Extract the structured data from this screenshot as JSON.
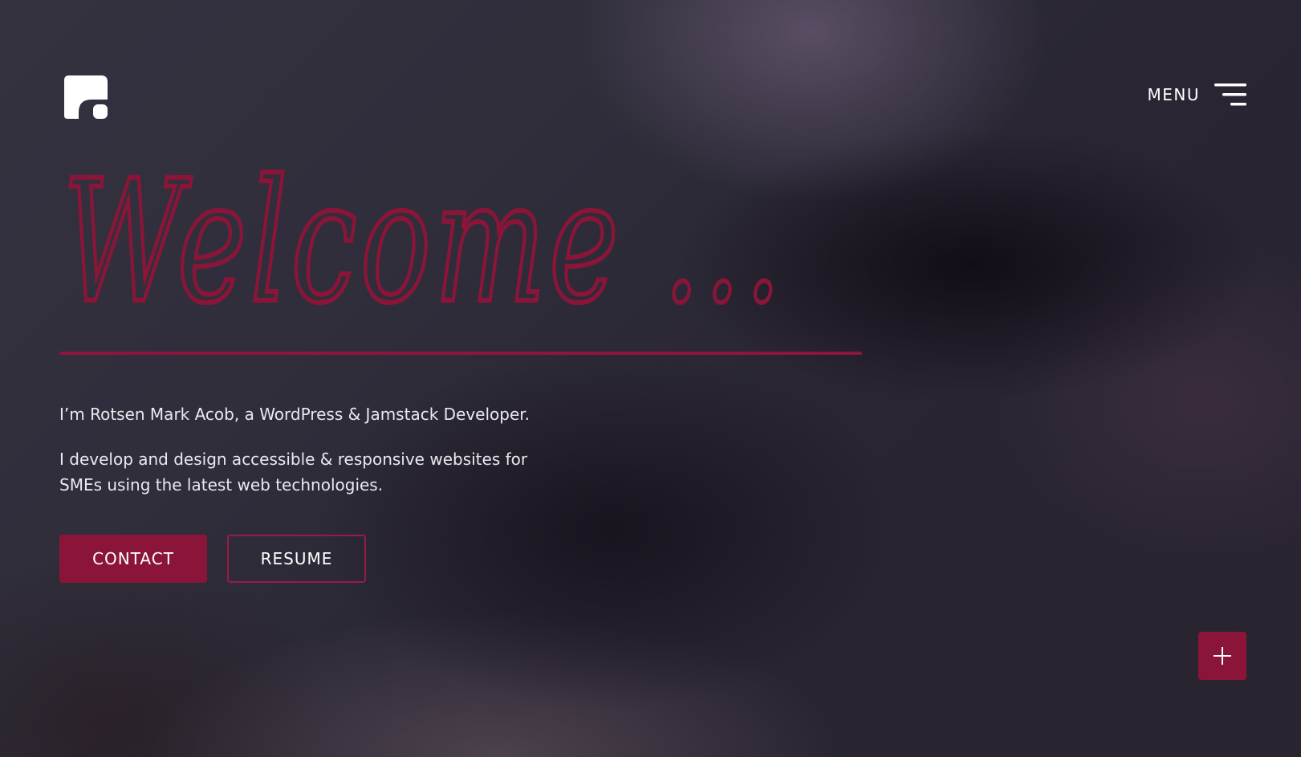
{
  "header": {
    "logo_icon": "logo-mark-icon",
    "menu_label": "MENU",
    "menu_icon": "hamburger-icon"
  },
  "hero": {
    "welcome_text": "Welcome ...",
    "intro": "I’m Rotsen Mark Acob, a WordPress & Jamstack Developer.",
    "description": "I develop and design accessible & responsive websites for SMEs using the latest web technologies."
  },
  "actions": {
    "contact_label": "CONTACT",
    "resume_label": "RESUME"
  },
  "fab": {
    "icon": "plus-icon"
  },
  "colors": {
    "accent": "#8b1538",
    "text": "#ebe8ef",
    "background": "#2e2c38"
  }
}
